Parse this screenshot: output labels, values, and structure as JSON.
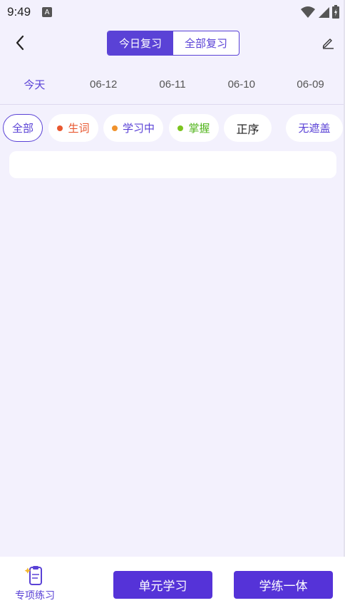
{
  "status_bar": {
    "time": "9:49",
    "app_icon_letter": "A",
    "icons": [
      "wifi-icon",
      "signal-icon",
      "battery-icon"
    ]
  },
  "header": {
    "back_icon": "chevron-left-icon",
    "edit_icon": "pencil-icon",
    "tabs": [
      {
        "label": "今日复习",
        "active": true
      },
      {
        "label": "全部复习",
        "active": false
      }
    ]
  },
  "date_tabs": [
    {
      "label": "今天",
      "active": true
    },
    {
      "label": "06-12",
      "active": false
    },
    {
      "label": "06-11",
      "active": false
    },
    {
      "label": "06-10",
      "active": false
    },
    {
      "label": "06-09",
      "active": false
    }
  ],
  "filters": {
    "all": "全部",
    "new": "生词",
    "learning": "学习中",
    "mastered": "掌握",
    "order": "正序",
    "no_cover": "无遮盖"
  },
  "colors": {
    "accent": "#5a42d6",
    "new": "#e8572f",
    "learning": "#f0922b",
    "mastered": "#7cc41f",
    "background": "#f3f1fd"
  },
  "bottom_bar": {
    "practice_label": "专项练习",
    "unit_study_label": "单元学习",
    "study_practice_label": "学练一体"
  }
}
